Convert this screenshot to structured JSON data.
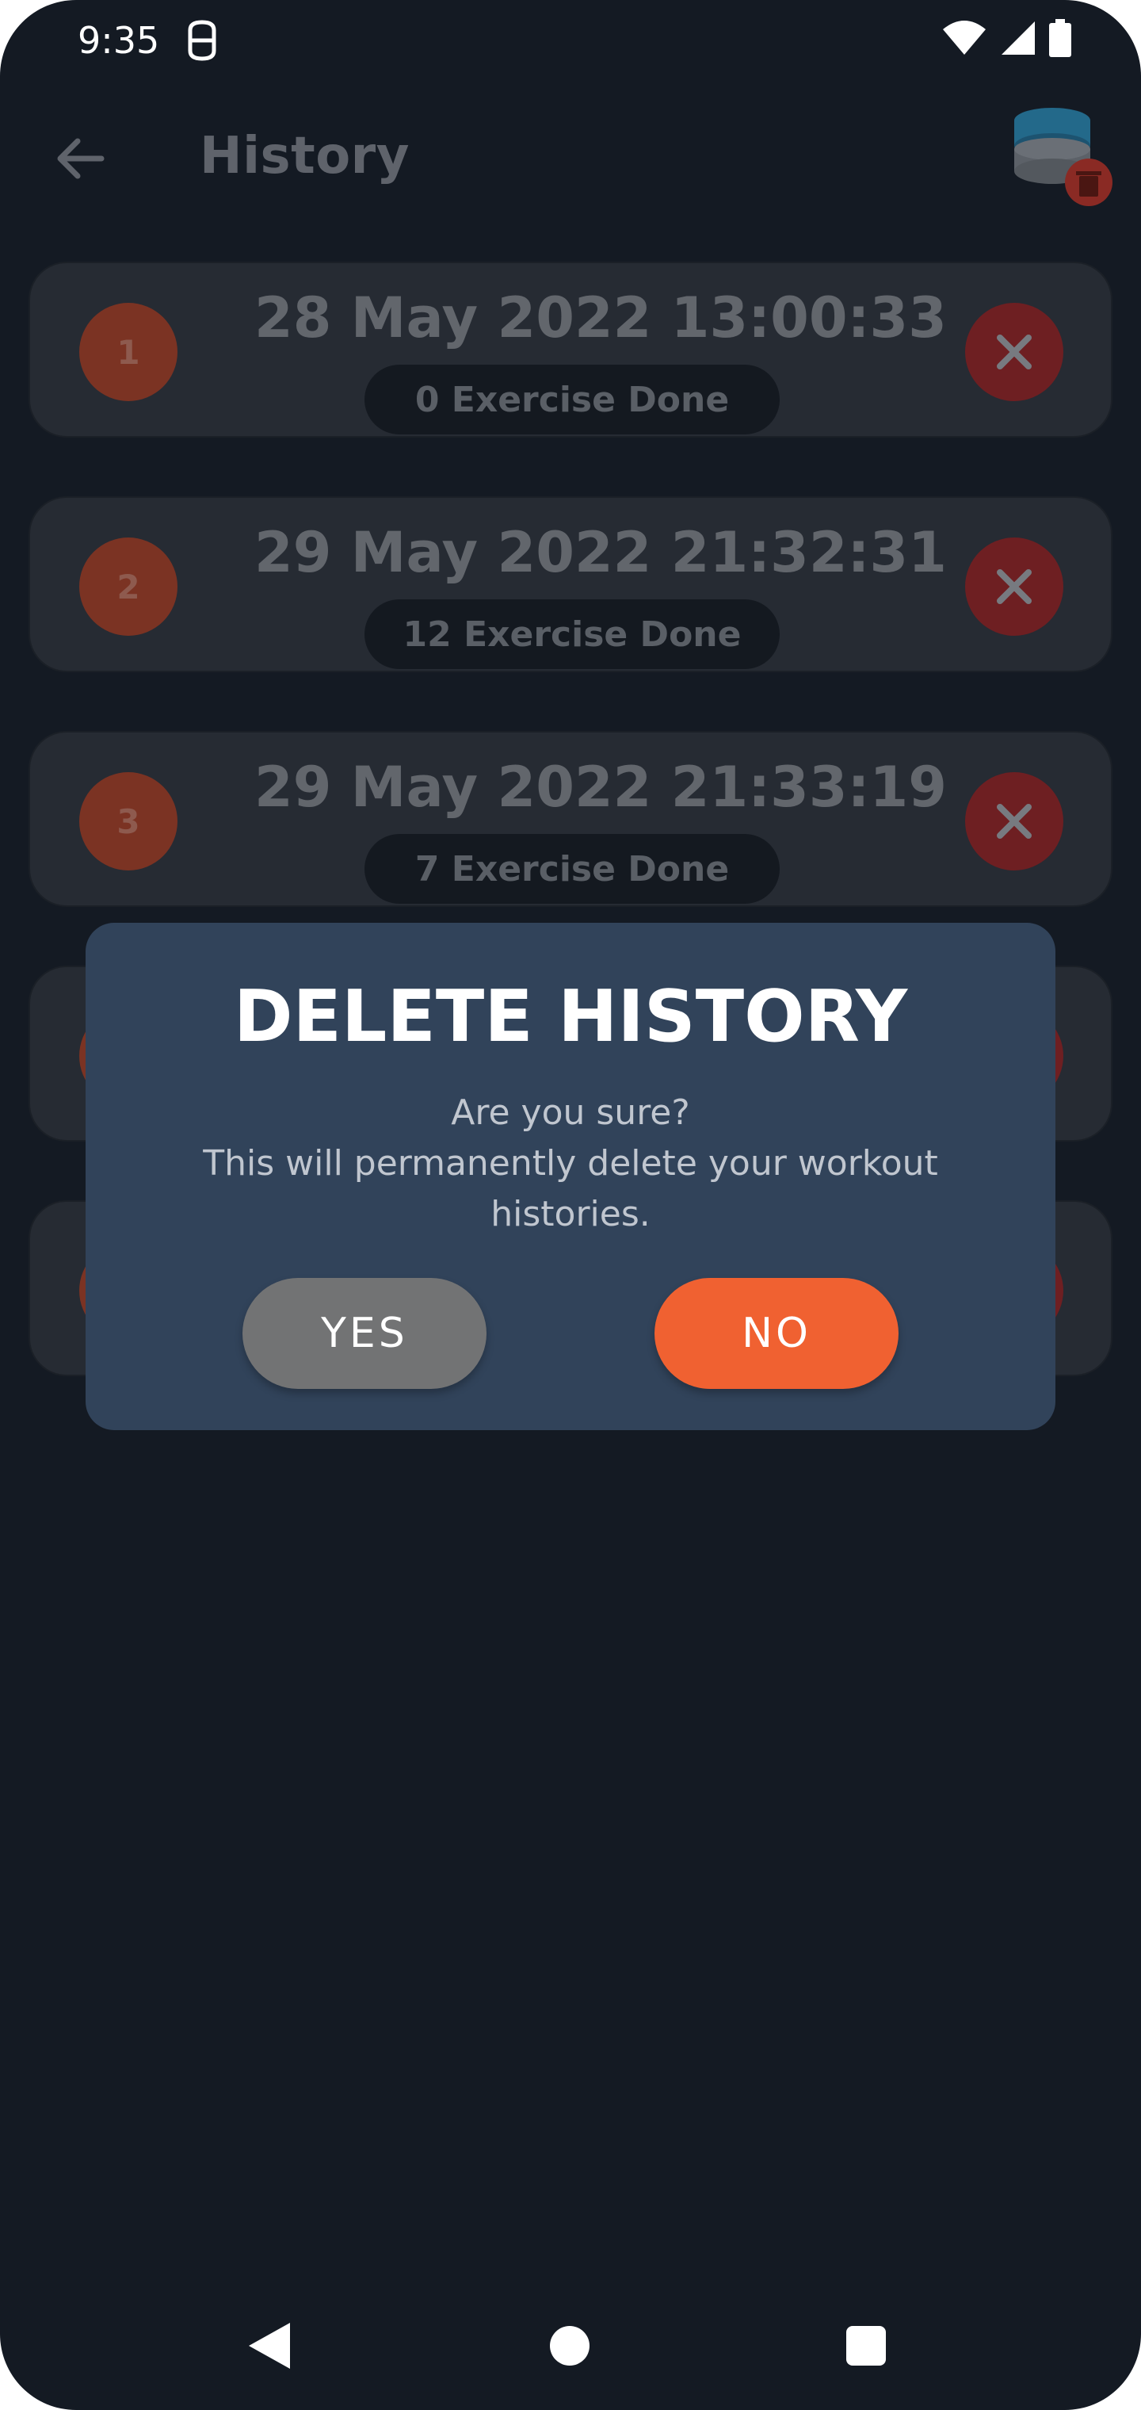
{
  "status_bar": {
    "time": "9:35",
    "icons": [
      "app-notification-icon",
      "wifi-icon",
      "cell-signal-icon",
      "battery-icon"
    ]
  },
  "app_bar": {
    "title": "History",
    "back_icon": "arrow-left-icon",
    "action_icon": "database-delete-icon"
  },
  "history": {
    "items": [
      {
        "index": "1",
        "date": "28 May 2022 13:00:33",
        "exercises": "0 Exercise Done"
      },
      {
        "index": "2",
        "date": "29 May 2022 21:32:31",
        "exercises": "12 Exercise Done"
      },
      {
        "index": "3",
        "date": "29 May 2022 21:33:19",
        "exercises": "7 Exercise Done"
      }
    ]
  },
  "dialog": {
    "title": "DELETE HISTORY",
    "message_line1": "Are you sure?",
    "message_line2": "This will permanently delete your workout histories.",
    "yes_label": "YES",
    "no_label": "NO"
  },
  "colors": {
    "background": "#141a23",
    "dialog": "#31435a",
    "accent": "#f06131",
    "yes_button": "#727374"
  },
  "nav_bar": {
    "icons": [
      "nav-back-icon",
      "nav-home-icon",
      "nav-recents-icon"
    ]
  }
}
